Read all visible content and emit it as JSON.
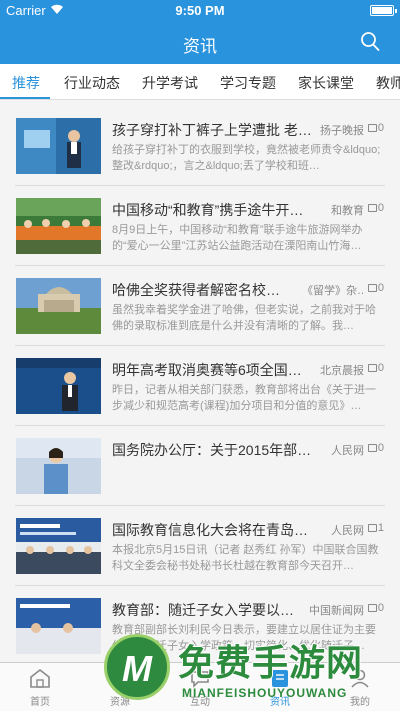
{
  "status_bar": {
    "carrier": "Carrier",
    "time": "9:50 PM"
  },
  "nav": {
    "title": "资讯"
  },
  "tabs": [
    "推荐",
    "行业动态",
    "升学考试",
    "学习专题",
    "家长课堂",
    "教师"
  ],
  "news": [
    {
      "title": "孩子穿打补丁裤子上学遭批 老…",
      "source": "扬子晚报",
      "comments": "0",
      "summary": "给孩子穿打补丁的衣服到学校，竟然被老师责令&ldquo;整改&rdquo;，言之&ldquo;丢了学校和班…"
    },
    {
      "title": "中国移动“和教育”携手途牛开启…",
      "source": "和教育",
      "comments": "0",
      "summary": "8月9日上午，中国移动“和教育”联手途牛旅游网举办的“爱心一公里”江苏站公益跑活动在溧阳南山竹海…"
    },
    {
      "title": "哈佛全奖获得者解密名校…",
      "source": "《留学》杂…",
      "comments": "0",
      "summary": "虽然我幸着奖学金进了哈佛，但老实说，之前我对于哈佛的录取标准到底是什么并没有清晰的了解。我…"
    },
    {
      "title": "明年高考取消奥赛等6项全国…",
      "source": "北京晨报",
      "comments": "0",
      "summary": "昨日，记者从相关部门获悉，教育部将出台《关于进一步减少和规范高考(课程)加分项目和分值的意见》…"
    },
    {
      "title": "国务院办公厅：关于2015年部…",
      "source": "人民网",
      "comments": "0",
      "summary": ""
    },
    {
      "title": "国际教育信息化大会将在青岛召开",
      "source": "人民网",
      "comments": "1",
      "summary": "本报北京5月15日讯（记者 赵秀红 孙军）中国联合国教科文全委会秘书处秘书长杜越在教育部今天召开…"
    },
    {
      "title": "教育部：随迁子女入学要以…",
      "source": "中国新闻网",
      "comments": "0",
      "summary": "教育部副部长刘利民今日表示，要建立以居住证为主要依据的随迁子女入学政策，切实简化、优化随迁子…"
    }
  ],
  "tabbar": [
    {
      "label": "首页",
      "icon": "home-icon"
    },
    {
      "label": "资源",
      "icon": "resource-icon"
    },
    {
      "label": "互动",
      "icon": "interact-icon"
    },
    {
      "label": "资讯",
      "icon": "news-icon"
    },
    {
      "label": "我的",
      "icon": "profile-icon"
    }
  ],
  "watermark": {
    "logo": "M",
    "text": "免费手游网",
    "sub": "MIANFEISHOUYOUWANG"
  },
  "colors": {
    "accent": "#2a93dd",
    "watermark": "#2d8b3d"
  }
}
